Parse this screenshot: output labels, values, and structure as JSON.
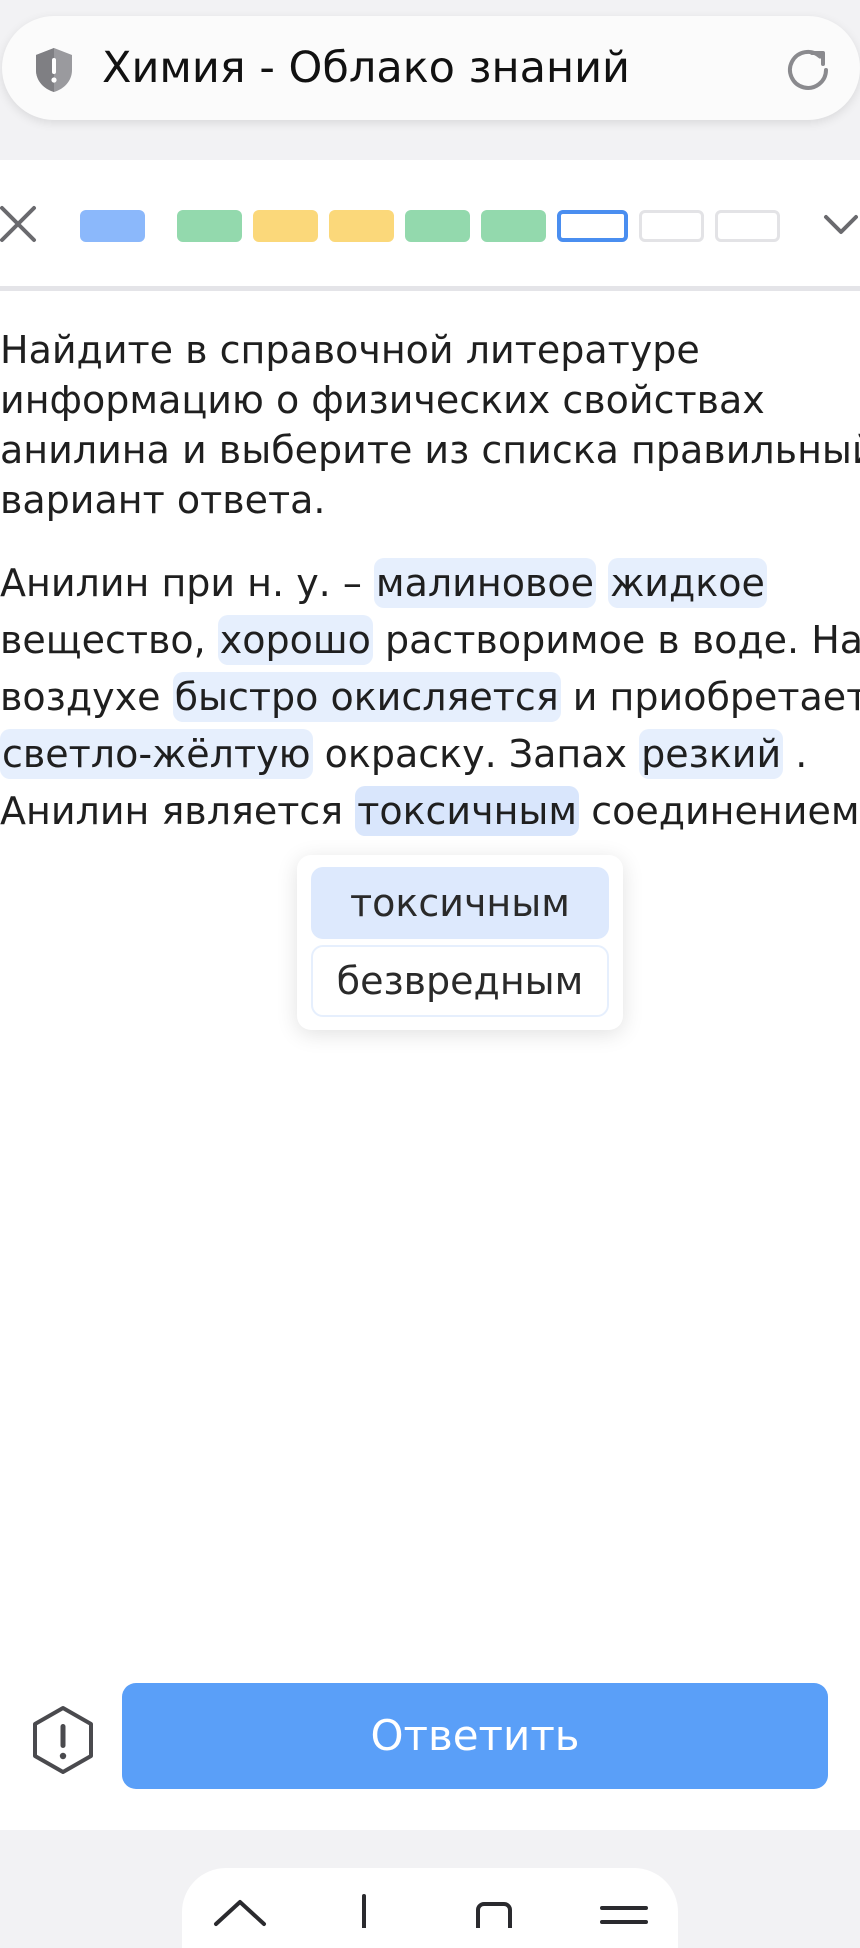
{
  "browser": {
    "page_title": "Химия - Облако знаний"
  },
  "progress": {
    "segments": [
      {
        "status": "current-viewed",
        "color": "#8bb8fb"
      },
      {
        "status": "correct",
        "color": "#93d9ad"
      },
      {
        "status": "partial",
        "color": "#fbd87a"
      },
      {
        "status": "partial",
        "color": "#fbd87a"
      },
      {
        "status": "correct",
        "color": "#93d9ad"
      },
      {
        "status": "correct",
        "color": "#93d9ad"
      },
      {
        "status": "active",
        "color": "#4a8ef0"
      },
      {
        "status": "empty",
        "color": "#e3e3e6"
      },
      {
        "status": "empty",
        "color": "#e3e3e6"
      }
    ]
  },
  "task": {
    "question_lines": [
      "Найдите в справочной литературе",
      "информацию о физических свойствах",
      "анилина и выберите из списка правильный",
      "вариант ответа."
    ],
    "passage": {
      "line1": {
        "t1": "Анилин при н. у. – ",
        "g1": "малиновое",
        "sp": " ",
        "g2": "жидкое"
      },
      "line2": {
        "t1": "вещество, ",
        "g1": "хорошо",
        "t2": " растворимое в воде. На"
      },
      "line3": {
        "t1": "воздухе ",
        "g1": "быстро окисляется",
        "t2": " и приобретает"
      },
      "line4": {
        "g1": "светло-жёлтую",
        "t1": " окраску. Запах ",
        "g2": "резкий",
        "t2": " ."
      },
      "line5": {
        "t1": "Анилин является ",
        "g1": "токсичным",
        "t2": " соединением."
      }
    },
    "dropdown_options": [
      {
        "label": "токсичным",
        "selected": true
      },
      {
        "label": "безвредным",
        "selected": false
      }
    ]
  },
  "actions": {
    "submit_label": "Ответить"
  },
  "icons": {
    "address_bar": "shield-icon",
    "reload": "reload-icon",
    "close": "close-icon",
    "collapse": "chevron-down-icon",
    "report": "report-problem-icon",
    "nav": [
      "home-icon",
      "download-icon",
      "tabs-icon",
      "menu-icon"
    ]
  },
  "colors": {
    "accent": "#5a9ff8",
    "gap_highlight": "#e6effd",
    "selected_option": "#dde9fd"
  }
}
